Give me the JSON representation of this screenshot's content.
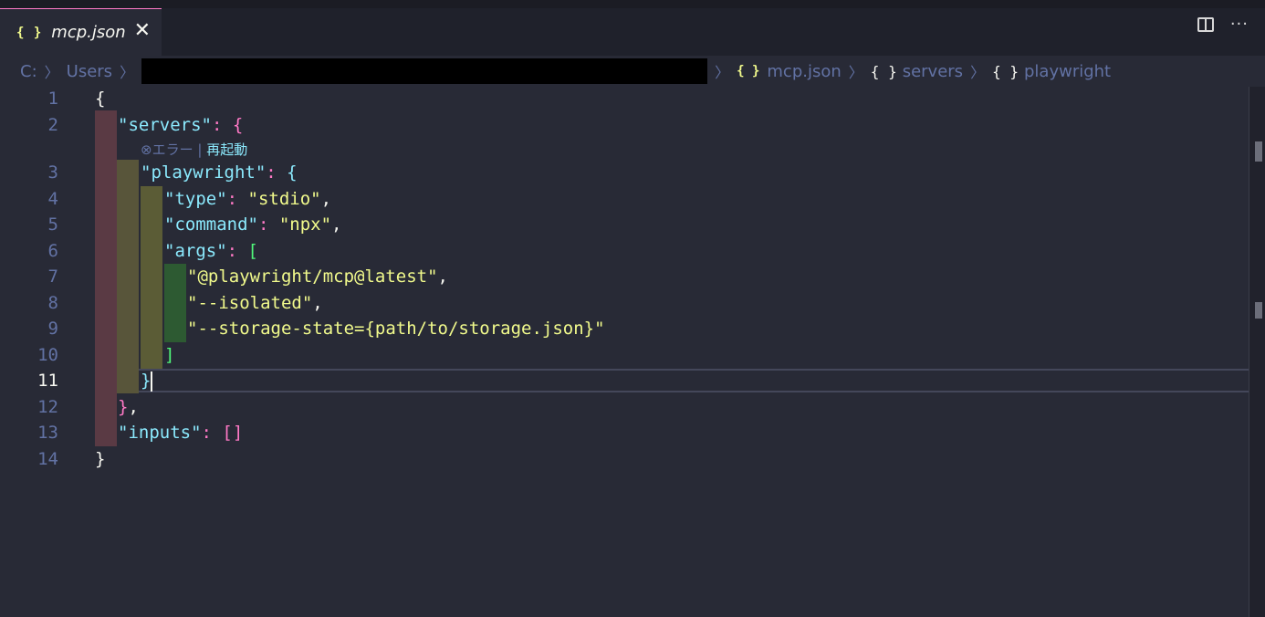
{
  "tab": {
    "icon": "{ }",
    "label": "mcp.json",
    "close": "✕"
  },
  "tab_actions": {
    "split_icon": "split-editor-icon",
    "more": "···"
  },
  "breadcrumb": {
    "items": [
      "C:",
      "Users"
    ],
    "file_icon": "{ }",
    "file": "mcp.json",
    "obj_icon": "{ }",
    "servers": "servers",
    "playwright": "playwright"
  },
  "codelens": {
    "error_icon": "⊗",
    "error": "エラー",
    "sep": " | ",
    "restart": "再起動"
  },
  "editor": {
    "line_numbers": [
      "1",
      "2",
      "3",
      "4",
      "5",
      "6",
      "7",
      "8",
      "9",
      "10",
      "11",
      "12",
      "13",
      "14"
    ],
    "active_line": "11",
    "lines": [
      [
        "{"
      ],
      [
        "\"servers\"",
        ": ",
        "{"
      ],
      [
        "\"playwright\"",
        ": ",
        "{"
      ],
      [
        "\"type\"",
        ": ",
        "\"stdio\"",
        ","
      ],
      [
        "\"command\"",
        ": ",
        "\"npx\"",
        ","
      ],
      [
        "\"args\"",
        ": ",
        "["
      ],
      [
        "\"@playwright/mcp@latest\"",
        ","
      ],
      [
        "\"--isolated\"",
        ","
      ],
      [
        "\"--storage-state={path/to/storage.json}\""
      ],
      [
        "]"
      ],
      [
        "}"
      ],
      [
        "}",
        ","
      ],
      [
        "\"inputs\"",
        ": ",
        "[]"
      ],
      [
        "}"
      ]
    ]
  }
}
